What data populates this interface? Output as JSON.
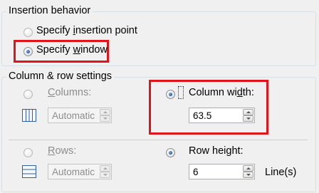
{
  "insertion_behavior": {
    "legend": "Insertion behavior",
    "specify_insertion_point": {
      "prefix": "Specify ",
      "underline": "i",
      "suffix": "nsertion point",
      "checked": false
    },
    "specify_window": {
      "prefix": "Specify ",
      "underline": "w",
      "suffix": "indow",
      "checked": true
    }
  },
  "column_row_settings": {
    "legend": "Column & row settings",
    "columns": {
      "underline": "C",
      "suffix": "olumns:",
      "checked": false,
      "value": "Automatic",
      "enabled": false,
      "icon": "columns-icon"
    },
    "column_width": {
      "prefix": "Column wi",
      "underline": "d",
      "suffix": "th:",
      "checked": true,
      "value": "63.5",
      "enabled": true
    },
    "rows": {
      "underline": "R",
      "suffix": "ows:",
      "checked": false,
      "value": "Automatic",
      "enabled": false,
      "icon": "rows-icon"
    },
    "row_height": {
      "prefix": "Row hei",
      "underline": "g",
      "suffix": "ht:",
      "checked": true,
      "value": "6",
      "enabled": true,
      "unit": "Line(s)"
    }
  },
  "colors": {
    "highlight": "#e0151b",
    "accent": "#1f5a9e"
  }
}
